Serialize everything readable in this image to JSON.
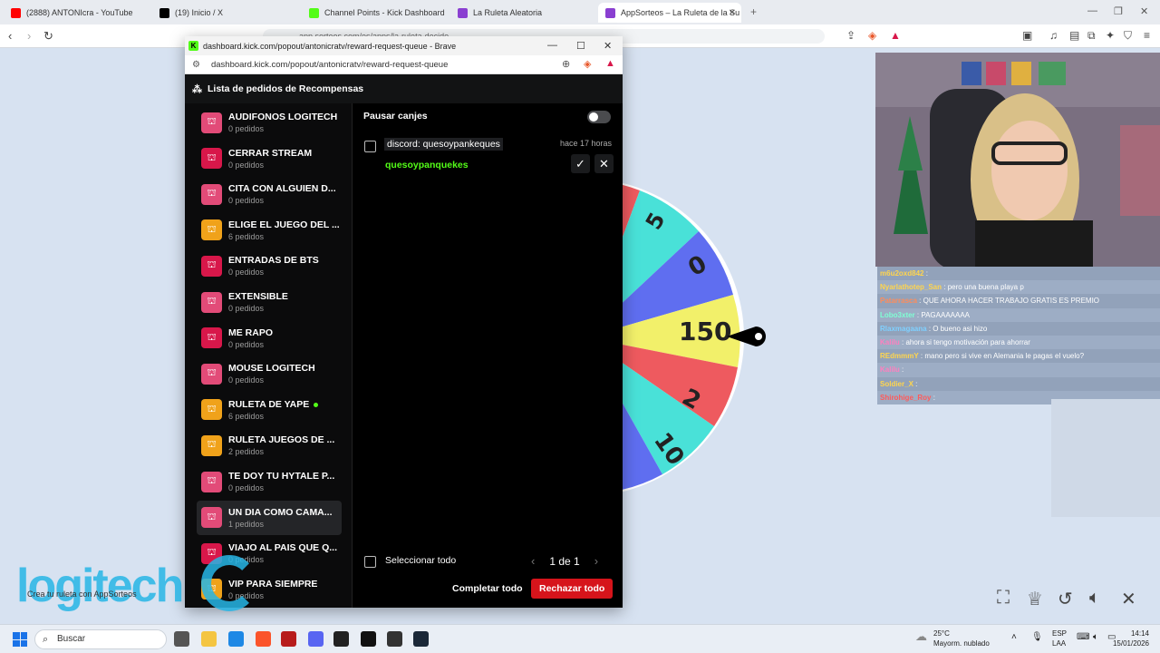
{
  "browser": {
    "tabs": [
      {
        "label": "(2888) ANTONIcra - YouTube",
        "color": "#ff0000"
      },
      {
        "label": "(19) Inicio / X",
        "color": "#000000"
      },
      {
        "label": "Channel Points - Kick Dashboard",
        "color": "#53fc18"
      },
      {
        "label": "La Ruleta Aleatoria",
        "color": "#8a3fd1"
      },
      {
        "label": "AppSorteos – La Ruleta de la Su",
        "color": "#8a3fd1"
      }
    ],
    "url": "app.sorteos.com/es/apps/la-ruleta-decide"
  },
  "popup": {
    "window_title": "dashboard.kick.com/popout/antonicratv/reward-request-queue - Brave",
    "url": "dashboard.kick.com/popout/antonicratv/reward-request-queue",
    "header": "Lista de pedidos de Recompensas",
    "rewards": [
      {
        "name": "AUDIFONOS LOGITECH",
        "count": "0 pedidos",
        "color": "#e24b78"
      },
      {
        "name": "CERRAR STREAM",
        "count": "0 pedidos",
        "color": "#d8174a"
      },
      {
        "name": "CITA CON ALGUIEN D...",
        "count": "0 pedidos",
        "color": "#e24b78"
      },
      {
        "name": "ELIGE EL JUEGO DEL ...",
        "count": "6 pedidos",
        "color": "#f0a21a"
      },
      {
        "name": "ENTRADAS DE BTS",
        "count": "0 pedidos",
        "color": "#d8174a"
      },
      {
        "name": "EXTENSIBLE",
        "count": "0 pedidos",
        "color": "#e24b78"
      },
      {
        "name": "ME RAPO",
        "count": "0 pedidos",
        "color": "#d8174a"
      },
      {
        "name": "MOUSE LOGITECH",
        "count": "0 pedidos",
        "color": "#e24b78"
      },
      {
        "name": "RULETA DE YAPE",
        "count": "6 pedidos",
        "color": "#f0a21a",
        "online": true
      },
      {
        "name": "RULETA JUEGOS DE ...",
        "count": "2 pedidos",
        "color": "#f0a21a"
      },
      {
        "name": "TE DOY TU HYTALE P...",
        "count": "0 pedidos",
        "color": "#e24b78"
      },
      {
        "name": "UN DIA COMO CAMA...",
        "count": "1 pedidos",
        "color": "#e24b78",
        "selected": true
      },
      {
        "name": "VIAJO AL PAIS QUE Q...",
        "count": "0 pedidos",
        "color": "#d8174a"
      },
      {
        "name": "VIP PARA SIEMPRE",
        "count": "0 pedidos",
        "color": "#f0a21a"
      }
    ],
    "pause_label": "Pausar canjes",
    "request": {
      "label": "discord: quesoypankeques",
      "time": "hace 17 horas",
      "user": "quesoypanquekes"
    },
    "select_all": "Seleccionar todo",
    "pager": "1 de 1",
    "complete_all": "Completar todo",
    "reject_all": "Rechazar todo"
  },
  "wheel": {
    "labels": [
      "5",
      "0",
      "150",
      "2",
      "10"
    ]
  },
  "chat": [
    {
      "user": "m6u2oxd842",
      "msg": ":",
      "color": "#ffd54d"
    },
    {
      "user": "Nyarlathotep_San",
      "msg": ": pero una buena playa p",
      "color": "#ffd54d"
    },
    {
      "user": "Patarrasca",
      "msg": ": QUE AHORA HACER TRABAJO GRATIS ES PREMIO",
      "color": "#ff8c5a"
    },
    {
      "user": "Lobo3xter",
      "msg": ": PAGAAAAAAA",
      "color": "#7fffd4"
    },
    {
      "user": "Rlaxmagaana",
      "msg": ": O bueno asi hizo",
      "color": "#7fd0ff"
    },
    {
      "user": "Kalilu",
      "msg": ": ahora si tengo motivación para ahorrar",
      "color": "#ff7fbf"
    },
    {
      "user": "REdmmmY",
      "msg": ": mano pero si vive en Alemania le pagas el vuelo?",
      "color": "#ffd54d"
    },
    {
      "user": "Kalilu",
      "msg": ":",
      "color": "#ff7fbf"
    },
    {
      "user": "Soldier_X",
      "msg": ":",
      "color": "#ffd54d"
    },
    {
      "user": "Shirohige_Roy",
      "msg": ":",
      "color": "#ff5a5a"
    }
  ],
  "overlay": {
    "brand": "logitech",
    "credit": "Crea tu ruleta con AppSorteos"
  },
  "taskbar": {
    "search": "Buscar",
    "weather_temp": "25°C",
    "weather_desc": "Mayorm. nublado",
    "lang_1": "ESP",
    "lang_2": "LAA",
    "time": "14:14",
    "date": "15/01/2026"
  }
}
